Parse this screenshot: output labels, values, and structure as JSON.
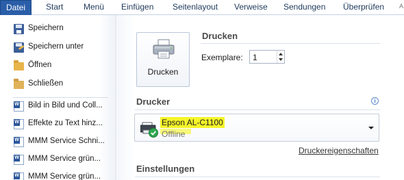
{
  "ribbon": {
    "tabs": [
      "Datei",
      "Start",
      "Menü",
      "Einfügen",
      "Seitenlayout",
      "Verweise",
      "Sendungen",
      "Überprüfen"
    ],
    "overflow": "A"
  },
  "menu": {
    "items": [
      {
        "label": "Speichern",
        "icon": "save-icon"
      },
      {
        "label": "Speichern unter",
        "icon": "save-as-icon"
      },
      {
        "label": "Öffnen",
        "icon": "folder-open-icon"
      },
      {
        "label": "Schließen",
        "icon": "folder-close-icon"
      },
      {
        "label": "Bild in Bild und Coll...",
        "icon": "word-document-icon"
      },
      {
        "label": "Effekte zu Text hinz...",
        "icon": "word-document-icon"
      },
      {
        "label": "MMM Service Schni...",
        "icon": "word-document-icon"
      },
      {
        "label": "MMM Service grün...",
        "icon": "word-document-icon"
      },
      {
        "label": "MMM Service grün...",
        "icon": "word-document-icon"
      }
    ]
  },
  "print": {
    "title": "Drucken",
    "button_label": "Drucken",
    "copies_label": "Exemplare:",
    "copies_value": "1"
  },
  "printer": {
    "title": "Drucker",
    "name": "Epson AL-C1100",
    "status": "Offline",
    "properties_link": "Druckereigenschaften",
    "highlight_color": "#f5f52a"
  },
  "settings": {
    "title": "Einstellungen"
  },
  "colors": {
    "file_tab": "#2a5ea8",
    "ribbon_text": "#1e395b"
  }
}
